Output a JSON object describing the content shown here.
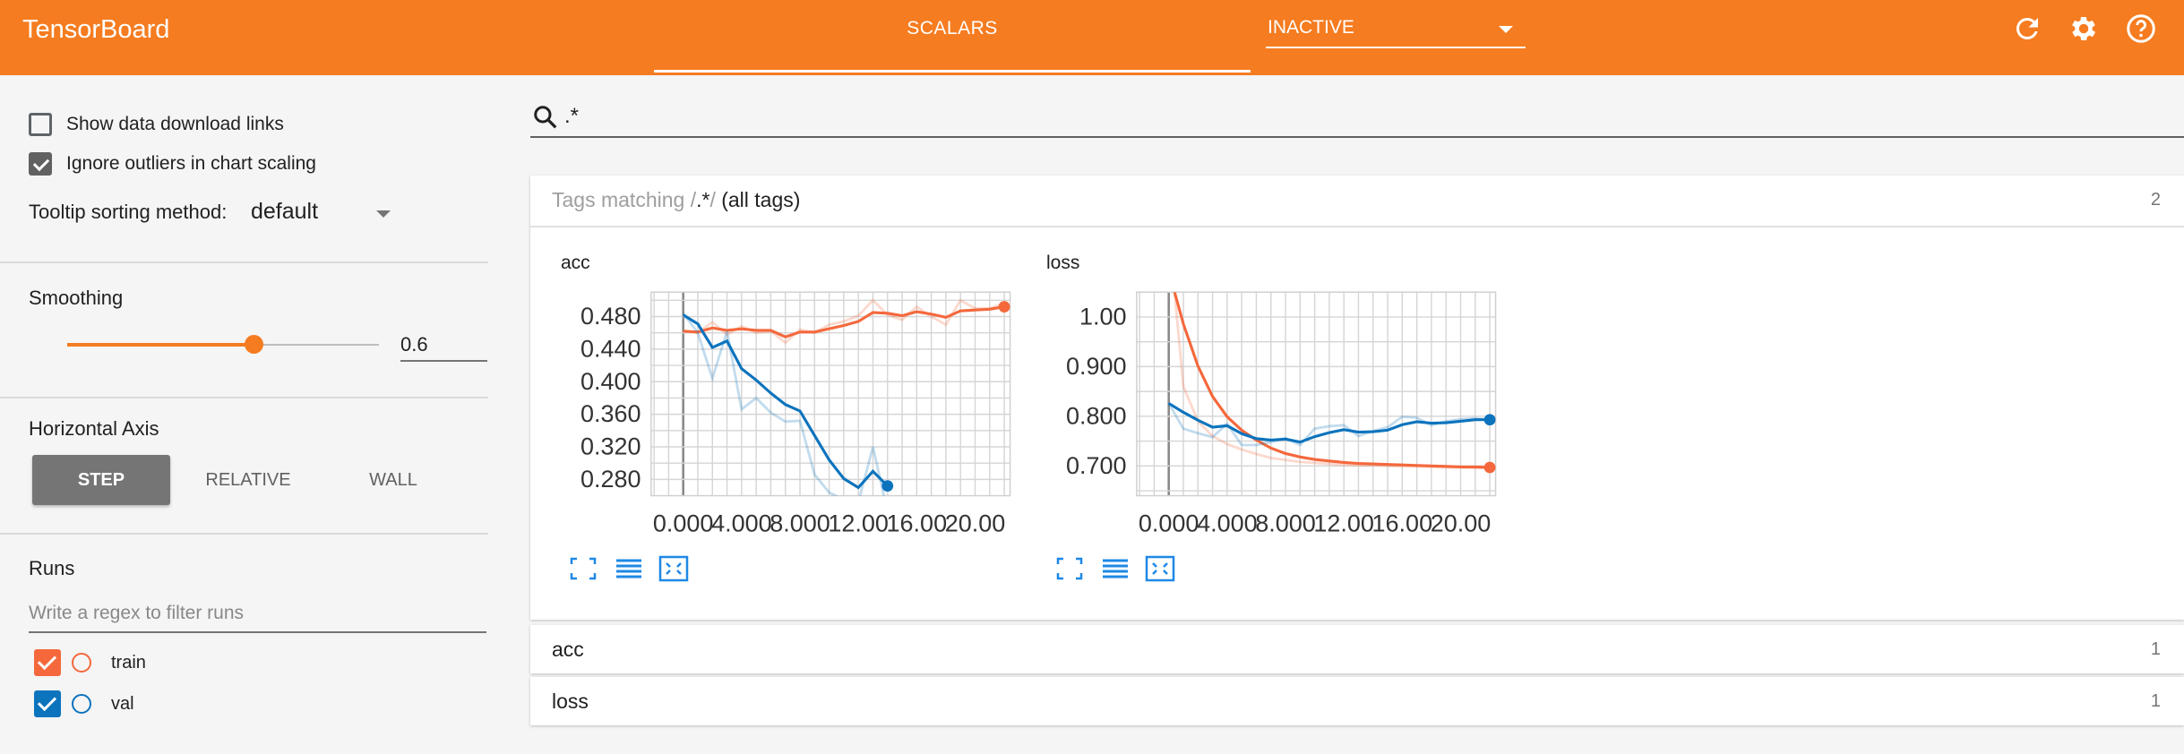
{
  "app": {
    "title": "TensorBoard"
  },
  "header": {
    "active_tab": "SCALARS",
    "run_selector": "INACTIVE",
    "icons": [
      "refresh-icon",
      "settings-gear-icon",
      "help-icon"
    ]
  },
  "sidebar": {
    "show_download_links": {
      "label": "Show data download links",
      "checked": false
    },
    "ignore_outliers": {
      "label": "Ignore outliers in chart scaling",
      "checked": true
    },
    "tooltip_sorting": {
      "label": "Tooltip sorting method:",
      "value": "default"
    },
    "smoothing": {
      "label": "Smoothing",
      "value": "0.6",
      "level": 0.6
    },
    "horizontal_axis": {
      "label": "Horizontal Axis",
      "options": [
        "STEP",
        "RELATIVE",
        "WALL"
      ],
      "selected": "STEP"
    },
    "runs": {
      "label": "Runs",
      "filter_placeholder": "Write a regex to filter runs",
      "items": [
        {
          "name": "train",
          "checked": true,
          "color": "#f4683c"
        },
        {
          "name": "val",
          "checked": true,
          "color": "#0c73bd"
        }
      ]
    }
  },
  "main": {
    "search_query": ".*",
    "tag_group": {
      "prefix": "Tags matching /",
      "regex": ".*",
      "suffix": "/",
      "all_label": "(all tags)",
      "count": "2"
    },
    "collapsed_groups": [
      {
        "name": "acc",
        "count": "1"
      },
      {
        "name": "loss",
        "count": "1"
      }
    ]
  },
  "colors": {
    "accent": "#f57c20",
    "train": "#f4683c",
    "val": "#0c73bd"
  },
  "chart_data": [
    {
      "type": "line",
      "title": "acc",
      "xlim": [
        -2.2,
        22.4
      ],
      "ylim": [
        0.26,
        0.51
      ],
      "x_ticks": [
        "0.000",
        "4.000",
        "8.000",
        "12.00",
        "16.00",
        "20.00"
      ],
      "y_ticks": [
        "0.480",
        "0.440",
        "0.400",
        "0.360",
        "0.320",
        "0.280"
      ],
      "series": [
        {
          "name": "train",
          "color": "#f4683c",
          "x": [
            0,
            1,
            2,
            3,
            4,
            5,
            6,
            7,
            8,
            9,
            10,
            11,
            12,
            13,
            14,
            15,
            16,
            17,
            18,
            19,
            20,
            21,
            22
          ],
          "smoothed": [
            0.462,
            0.461,
            0.466,
            0.463,
            0.465,
            0.463,
            0.463,
            0.455,
            0.461,
            0.461,
            0.465,
            0.469,
            0.474,
            0.485,
            0.484,
            0.481,
            0.486,
            0.483,
            0.479,
            0.487,
            0.488,
            0.489,
            0.492
          ],
          "raw": [
            0.462,
            0.46,
            0.473,
            0.458,
            0.468,
            0.46,
            0.462,
            0.448,
            0.464,
            0.46,
            0.47,
            0.474,
            0.481,
            0.5,
            0.482,
            0.476,
            0.492,
            0.48,
            0.47,
            0.5,
            0.49,
            0.49,
            0.496
          ]
        },
        {
          "name": "val",
          "color": "#0c73bd",
          "x": [
            0,
            1,
            2,
            3,
            4,
            5,
            6,
            7,
            8,
            9,
            10,
            11,
            12,
            13,
            14
          ],
          "smoothed": [
            0.482,
            0.471,
            0.442,
            0.45,
            0.416,
            0.402,
            0.386,
            0.372,
            0.364,
            0.334,
            0.304,
            0.281,
            0.27,
            0.29,
            0.272
          ],
          "raw": [
            0.484,
            0.46,
            0.404,
            0.462,
            0.366,
            0.38,
            0.362,
            0.351,
            0.352,
            0.286,
            0.264,
            0.255,
            0.252,
            0.32,
            0.24
          ]
        }
      ]
    },
    {
      "type": "line",
      "title": "loss",
      "xlim": [
        -2.2,
        22.4
      ],
      "ylim": [
        0.64,
        1.05
      ],
      "x_ticks": [
        "0.000",
        "4.000",
        "8.000",
        "12.00",
        "16.00",
        "20.00"
      ],
      "y_ticks": [
        "1.00",
        "0.900",
        "0.800",
        "0.700"
      ],
      "series": [
        {
          "name": "train",
          "color": "#f4683c",
          "x": [
            0.4,
            1,
            2,
            3,
            4,
            5,
            6,
            7,
            8,
            9,
            10,
            11,
            12,
            13,
            14,
            15,
            16,
            17,
            18,
            19,
            20,
            21,
            22
          ],
          "smoothed": [
            1.05,
            0.986,
            0.901,
            0.84,
            0.799,
            0.772,
            0.752,
            0.736,
            0.725,
            0.718,
            0.713,
            0.71,
            0.707,
            0.705,
            0.704,
            0.703,
            0.702,
            0.701,
            0.7,
            0.699,
            0.698,
            0.698,
            0.697
          ],
          "raw": [
            1.05,
            0.86,
            0.79,
            0.76,
            0.744,
            0.733,
            0.724,
            0.716,
            0.712,
            0.708,
            0.706,
            0.704,
            0.702,
            0.701,
            0.701,
            0.7,
            0.699,
            0.699,
            0.698,
            0.697,
            0.697,
            0.696,
            0.696
          ]
        },
        {
          "name": "val",
          "color": "#0c73bd",
          "x": [
            0,
            1,
            2,
            3,
            4,
            5,
            6,
            7,
            8,
            9,
            10,
            11,
            12,
            13,
            14,
            15,
            16,
            17,
            18,
            19,
            20,
            21,
            22
          ],
          "smoothed": [
            0.826,
            0.808,
            0.792,
            0.778,
            0.781,
            0.765,
            0.755,
            0.752,
            0.754,
            0.748,
            0.759,
            0.767,
            0.773,
            0.768,
            0.769,
            0.772,
            0.783,
            0.789,
            0.786,
            0.787,
            0.79,
            0.793,
            0.793
          ],
          "raw": [
            0.826,
            0.775,
            0.766,
            0.758,
            0.785,
            0.742,
            0.742,
            0.748,
            0.756,
            0.742,
            0.775,
            0.78,
            0.782,
            0.76,
            0.77,
            0.778,
            0.799,
            0.797,
            0.782,
            0.79,
            0.794,
            0.796,
            0.793
          ]
        }
      ]
    }
  ]
}
